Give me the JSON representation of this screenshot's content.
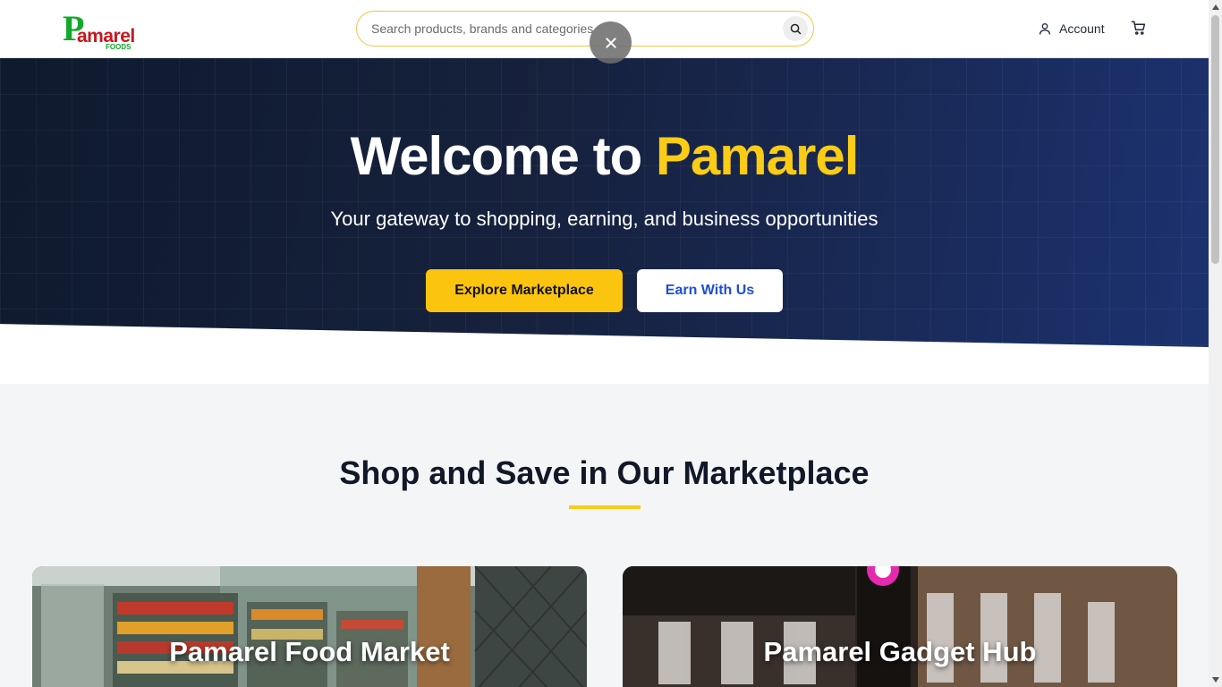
{
  "header": {
    "logo": {
      "letter": "P",
      "name": "amarel",
      "sub": "FOODS"
    },
    "search_placeholder": "Search products, brands and categories",
    "account_label": "Account"
  },
  "hero": {
    "title_prefix": "Welcome to ",
    "title_highlight": "Pamarel",
    "subtitle": "Your gateway to shopping, earning, and business opportunities",
    "primary_button": "Explore Marketplace",
    "secondary_button": "Earn With Us"
  },
  "section": {
    "title": "Shop and Save in Our Marketplace",
    "cards": [
      {
        "title": "Pamarel Food Market"
      },
      {
        "title": "Pamarel Gadget Hub"
      }
    ]
  },
  "icons": {
    "search": "search-icon",
    "close": "close-icon",
    "account": "user-icon",
    "cart": "cart-icon"
  },
  "colors": {
    "brand_yellow": "#facc15",
    "brand_green": "#12a82a",
    "brand_red": "#c8161d",
    "hero_dark": "#0f1a2e",
    "hero_blue": "#1c3270",
    "link_blue": "#1d4ed8"
  }
}
